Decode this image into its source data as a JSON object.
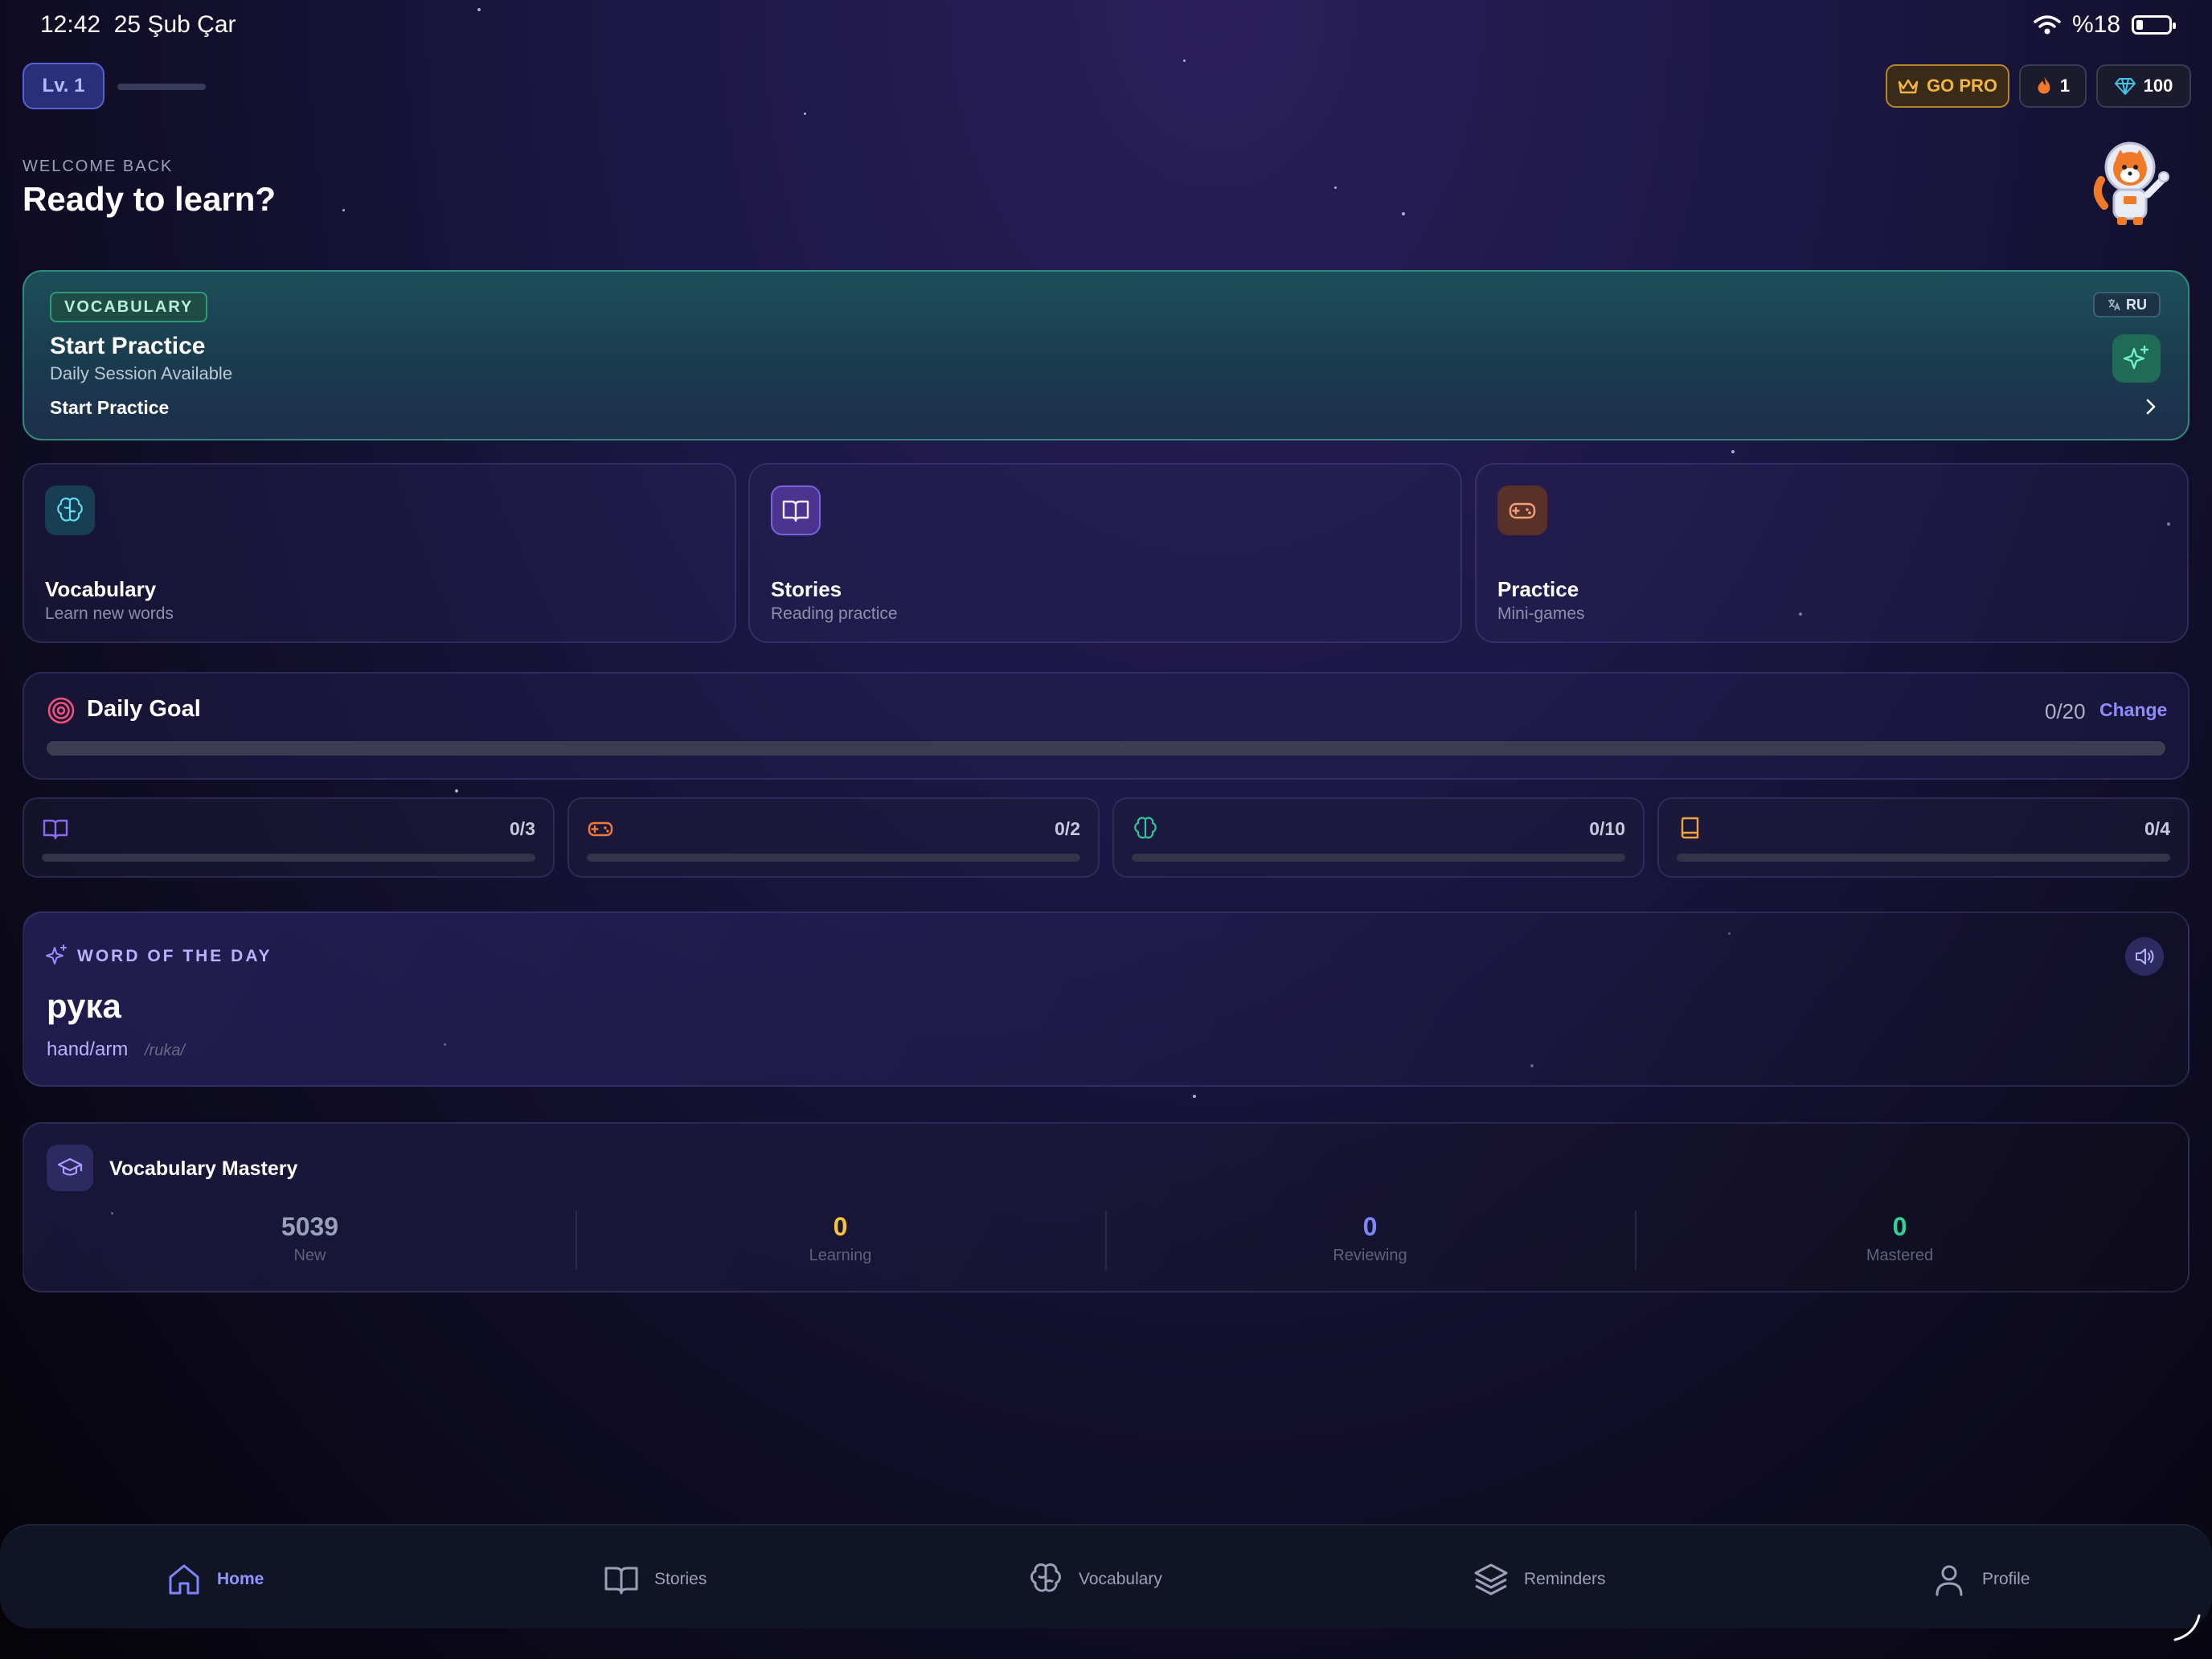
{
  "status": {
    "time": "12:42",
    "date": "25 Şub Çar",
    "battery": "%18"
  },
  "header": {
    "level": "Lv. 1",
    "go_pro": "GO PRO",
    "streak": "1",
    "gems": "100"
  },
  "welcome": {
    "eyebrow": "WELCOME BACK",
    "title": "Ready to learn?"
  },
  "hero": {
    "badge": "VOCABULARY",
    "title": "Start Practice",
    "subtitle": "Daily Session Available",
    "cta": "Start Practice",
    "language": "RU"
  },
  "tiles": [
    {
      "title": "Vocabulary",
      "subtitle": "Learn new words",
      "icon": "brain-icon"
    },
    {
      "title": "Stories",
      "subtitle": "Reading practice",
      "icon": "book-open-icon"
    },
    {
      "title": "Practice",
      "subtitle": "Mini-games",
      "icon": "gamepad-icon"
    }
  ],
  "daily_goal": {
    "title": "Daily Goal",
    "count": "0/20",
    "change": "Change",
    "progress": 0
  },
  "subgoals": [
    {
      "icon": "book-open-icon",
      "count": "0/3",
      "progress": 0,
      "color": "#8b6cf0"
    },
    {
      "icon": "gamepad-icon",
      "count": "0/2",
      "progress": 0,
      "color": "#f07a3a"
    },
    {
      "icon": "brain-icon",
      "count": "0/10",
      "progress": 0,
      "color": "#2fc79a"
    },
    {
      "icon": "book-icon",
      "count": "0/4",
      "progress": 0,
      "color": "#f2a33a"
    }
  ],
  "word_of_day": {
    "label": "WORD OF THE DAY",
    "word": "рука",
    "translation": "hand/arm",
    "transliteration": "/ruka/"
  },
  "mastery": {
    "title": "Vocabulary Mastery",
    "stats": [
      {
        "value": "5039",
        "label": "New",
        "color": "#9aa0b8"
      },
      {
        "value": "0",
        "label": "Learning",
        "color": "#f5c342"
      },
      {
        "value": "0",
        "label": "Reviewing",
        "color": "#7c86ff"
      },
      {
        "value": "0",
        "label": "Mastered",
        "color": "#2fd39a"
      }
    ]
  },
  "nav": [
    {
      "label": "Home",
      "icon": "home-icon",
      "active": true
    },
    {
      "label": "Stories",
      "icon": "book-open-icon"
    },
    {
      "label": "Vocabulary",
      "icon": "brain-icon"
    },
    {
      "label": "Reminders",
      "icon": "layers-icon"
    },
    {
      "label": "Profile",
      "icon": "user-icon"
    }
  ],
  "colors": {
    "accent": "#8f8cff",
    "hero_border": "#2f8a7e",
    "gold": "#f2b640"
  }
}
